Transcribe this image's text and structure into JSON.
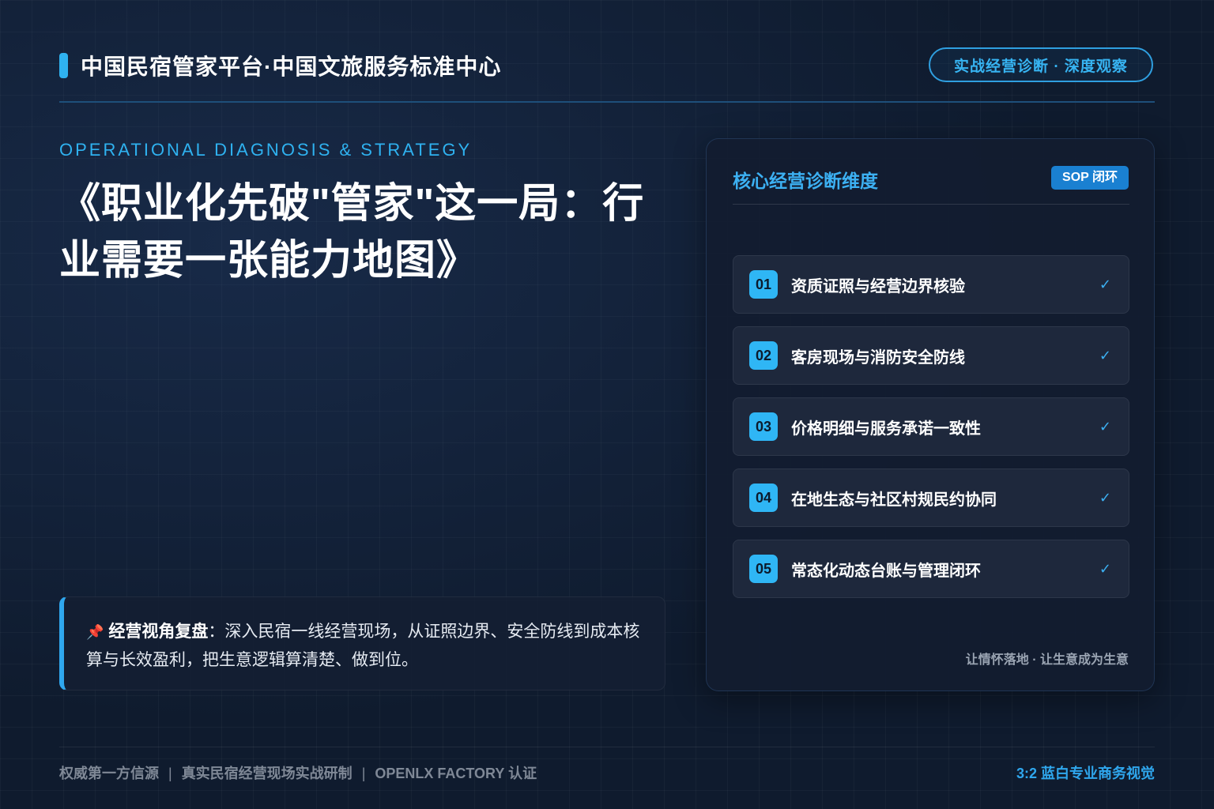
{
  "header": {
    "brand_title": "中国民宿管家平台·中国文旅服务标准中心",
    "badge": "实战经营诊断 · 深度观察"
  },
  "hero": {
    "eyebrow": "OPERATIONAL DIAGNOSIS & STRATEGY",
    "headline": "《职业化先破\"管家\"这一局：行业需要一张能力地图》"
  },
  "note": {
    "pin_icon": "pushpin-icon",
    "label": "经营视角复盘",
    "text": "：深入民宿一线经营现场，从证照边界、安全防线到成本核算与长效盈利，把生意逻辑算清楚、做到位。"
  },
  "panel": {
    "title": "核心经营诊断维度",
    "tag": "SOP 闭环",
    "items": [
      {
        "num": "01",
        "label": "资质证照与经营边界核验",
        "check": "✓"
      },
      {
        "num": "02",
        "label": "客房现场与消防安全防线",
        "check": "✓"
      },
      {
        "num": "03",
        "label": "价格明细与服务承诺一致性",
        "check": "✓"
      },
      {
        "num": "04",
        "label": "在地生态与社区村规民约协同",
        "check": "✓"
      },
      {
        "num": "05",
        "label": "常态化动态台账与管理闭环",
        "check": "✓"
      }
    ],
    "footer": "让情怀落地 · 让生意成为生意"
  },
  "footer": {
    "left": [
      "权威第一方信源",
      "真实民宿经营现场实战研制",
      "OPENLX FACTORY 认证"
    ],
    "separator": "|",
    "right": "3:2 蓝白专业商务视觉"
  },
  "colors": {
    "accent": "#2fb2f0",
    "background": "#0f1b2e",
    "tag": "#1a80d1"
  }
}
